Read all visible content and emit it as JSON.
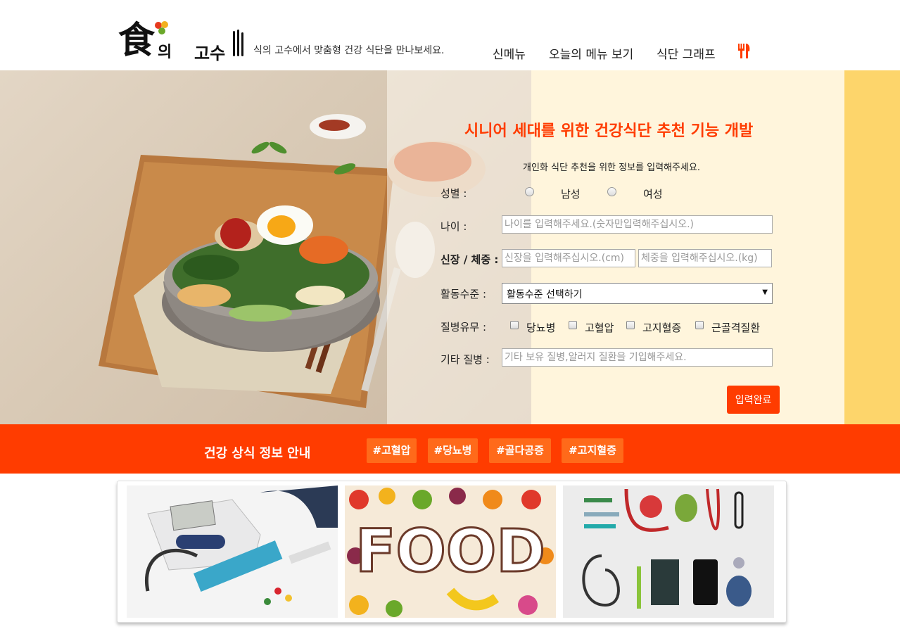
{
  "header": {
    "logo_char": "食",
    "logo_ui": "의",
    "logo_gosu": "고수",
    "tagline": "식의 고수에서 맞춤형 건강 식단을 만나보세요.",
    "nav": [
      "신메뉴",
      "오늘의 메뉴 보기",
      "식단 그래프"
    ],
    "nav_icon": "fork-knife-icon"
  },
  "form": {
    "title": "시니어 세대를 위한 건강식단 추천 기능 개발",
    "subtitle": "개인화 식단 추천을 위한 정보를 입력해주세요.",
    "gender_label": "성별 :",
    "gender_options": [
      "남성",
      "여성"
    ],
    "age_label": "나이 :",
    "age_placeholder": "나이를 입력해주세요.(숫자만입력해주십시오.)",
    "height_weight_label": "신장 / 체중 :",
    "height_placeholder": "신장을 입력해주십시오.(cm)",
    "weight_placeholder": "체중을 입력해주십시오.(kg)",
    "activity_label": "활동수준 :",
    "activity_selected": "활동수준 선택하기",
    "disease_label": "질병유무 :",
    "diseases": [
      "당뇨병",
      "고혈압",
      "고지혈증",
      "근골격질환"
    ],
    "other_label": "기타 질병 :",
    "other_placeholder": "기타 보유 질병,알러지 질환을 기입해주세요.",
    "submit": "입력완료"
  },
  "band": {
    "title": "건강 상식 정보 안내",
    "tags": [
      "#고혈압",
      "#당뇨병",
      "#골다공증",
      "#고지혈증"
    ]
  },
  "gallery": {
    "items": [
      "blood-pressure-monitor-photo",
      "food-word-produce-photo",
      "medical-equipment-flatlay-photo"
    ],
    "food_word": "FOOD"
  },
  "colors": {
    "accent": "#ff3c00",
    "tag_bg": "#ff6a1a",
    "form_bg": "#fff5dc",
    "strip": "#fdd56b"
  }
}
